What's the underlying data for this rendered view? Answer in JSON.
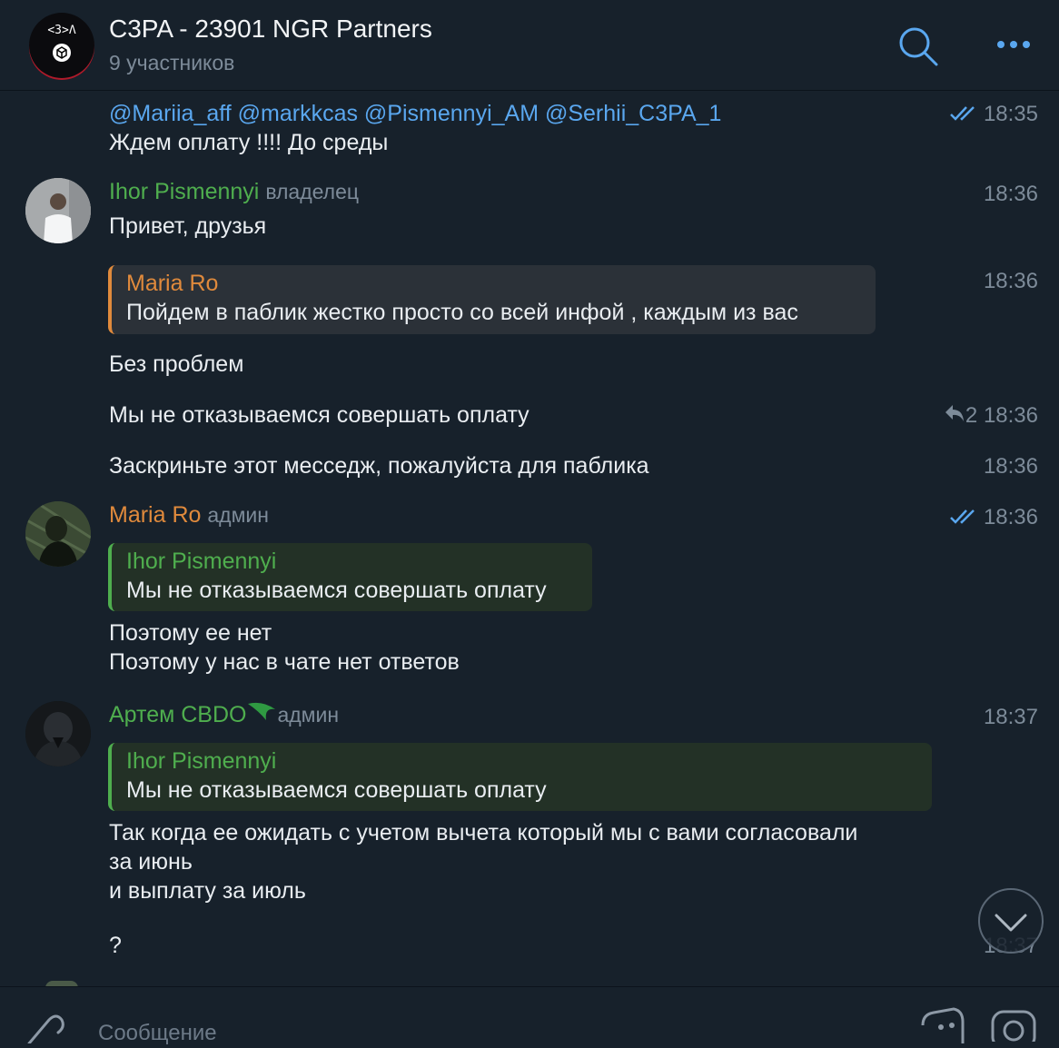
{
  "header": {
    "title": "C3PA - 23901 NGR Partners",
    "subtitle": "9 участников",
    "logo_text": "<3>Λ"
  },
  "messages": {
    "m1": {
      "mentions": "@Mariia_aff @markkcas @Pismennyi_AM @Serhii_C3PA_1",
      "text": "Ждем оплату !!!! До среды",
      "time": "18:35"
    },
    "m2": {
      "author": "Ihor Pismennyi",
      "role": "владелец",
      "text": "Привет, друзья",
      "time": "18:36"
    },
    "m3": {
      "reply_author": "Maria Ro",
      "reply_text": "Пойдем в паблик жестко просто со всей инфой , каждым из вас",
      "time": "18:36"
    },
    "m4": {
      "text": "Без проблем"
    },
    "m5": {
      "text": "Мы не отказываемся совершать оплату",
      "replies": "2",
      "time": "18:36"
    },
    "m6": {
      "text": "Заскриньте этот месседж, пожалуйста для паблика",
      "time": "18:36"
    },
    "m7": {
      "author": "Maria Ro",
      "role": "админ",
      "time": "18:36",
      "reply_author": "Ihor Pismennyi",
      "reply_text": "Мы не отказываемся совершать оплату",
      "line1": "Поэтому ее нет",
      "line2": "Поэтому у нас в чате нет ответов"
    },
    "m8": {
      "author": "Артем CBDO",
      "role": "админ",
      "time": "18:37",
      "reply_author": "Ihor Pismennyi",
      "reply_text": "Мы не отказываемся совершать оплату",
      "line1": "Так когда ее ожидать с учетом вычета который мы с вами согласовали",
      "line2": "за июнь",
      "line3": "и выплату за июль",
      "line4": "?",
      "time2": "18:37"
    }
  },
  "input": {
    "placeholder": "Сообщение"
  },
  "colors": {
    "background": "#17212b",
    "accent": "#5aa7ef",
    "green_name": "#4fae4e",
    "orange_name": "#e08a3c"
  }
}
